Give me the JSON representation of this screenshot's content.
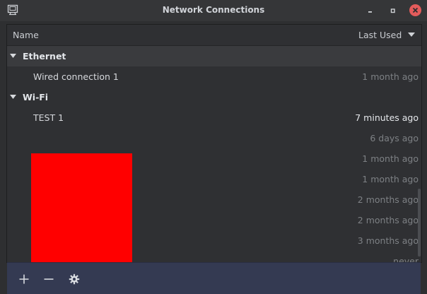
{
  "window": {
    "title": "Network Connections",
    "close_color": "#e35b5b"
  },
  "columns": {
    "name": "Name",
    "last_used": "Last Used"
  },
  "groups": [
    {
      "label": "Ethernet",
      "connections": [
        {
          "name": "Wired connection 1",
          "last_used": "1 month ago"
        }
      ]
    },
    {
      "label": "Wi-Fi",
      "connections": [
        {
          "name": "TEST 1",
          "last_used": "7 minutes ago"
        },
        {
          "name": "",
          "last_used": "6 days ago"
        },
        {
          "name": "",
          "last_used": "1 month ago"
        },
        {
          "name": "",
          "last_used": "1 month ago"
        },
        {
          "name": "",
          "last_used": "2 months ago"
        },
        {
          "name": "",
          "last_used": "2 months ago"
        },
        {
          "name": "",
          "last_used": "3 months ago"
        },
        {
          "name": "",
          "last_used": "never"
        }
      ]
    }
  ],
  "toolbar": {
    "add_icon": "plus-icon",
    "remove_icon": "minus-icon",
    "settings_icon": "gear-icon"
  },
  "colors": {
    "redaction": "#ff0000",
    "toolbar": "#343a52"
  }
}
